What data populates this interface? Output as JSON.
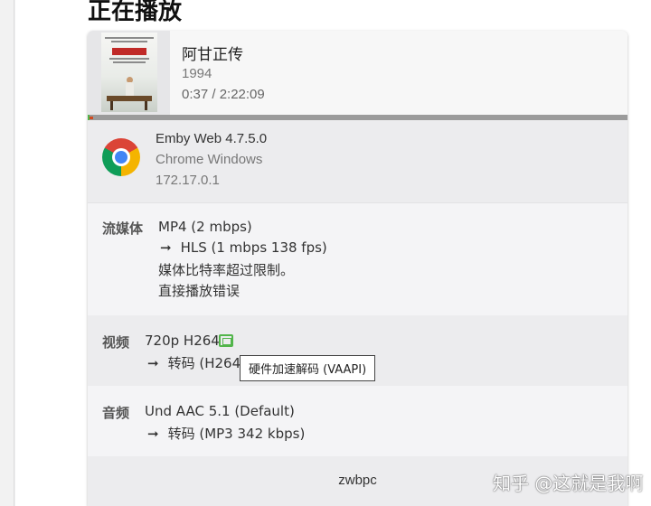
{
  "page": {
    "title": "正在播放"
  },
  "now_playing": {
    "title": "阿甘正传",
    "year": "1994",
    "time": "0:37 / 2:22:09",
    "progress": 0.004
  },
  "client": {
    "app": "Emby Web 4.7.5.0",
    "os": "Chrome Windows",
    "ip": "172.17.0.1",
    "icon": "chrome-icon"
  },
  "stream": {
    "label": "流媒体",
    "source": "MP4 (2 mbps)",
    "arrow": "➞",
    "target": "HLS (1 mbps 138 fps)",
    "reason": "媒体比特率超过限制。",
    "error": "直接播放错误"
  },
  "video": {
    "label": "视频",
    "source": "720p H264",
    "arrow": "➞",
    "target": "转码 (H264",
    "hw_icon": "hardware-decode-icon",
    "tooltip": "硬件加速解码 (VAAPI)"
  },
  "audio": {
    "label": "音频",
    "source": "Und AAC 5.1 (Default)",
    "arrow": "➞",
    "target": "转码 (MP3 342 kbps)"
  },
  "user": {
    "name": "zwbpc"
  },
  "watermark": "知乎 @这就是我啊",
  "colors": {
    "accent": "#52b54b",
    "progress_track": "#9b9b9b"
  }
}
